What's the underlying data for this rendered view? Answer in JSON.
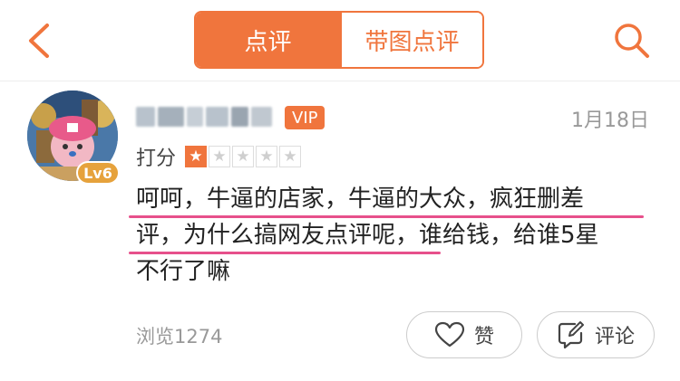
{
  "header": {
    "tabs": [
      {
        "label": "点评",
        "active": true
      },
      {
        "label": "带图点评",
        "active": false
      }
    ],
    "back_icon": "chevron-left-icon",
    "search_icon": "search-icon",
    "accent_color": "#f0753d"
  },
  "review": {
    "user": {
      "avatar_level": "Lv6",
      "vip_label": "VIP"
    },
    "date": "1月18日",
    "rating_label": "打分",
    "rating": 1,
    "rating_max": 5,
    "content_lines": [
      "呵呵，牛逼的店家，牛逼的大众，疯狂删差",
      "评，为什么搞网友点评呢，谁给钱，给谁5星",
      "不行了嘛"
    ],
    "views": "浏览1274",
    "like_label": "赞",
    "comment_label": "评论",
    "highlight_color": "#e7508b"
  }
}
